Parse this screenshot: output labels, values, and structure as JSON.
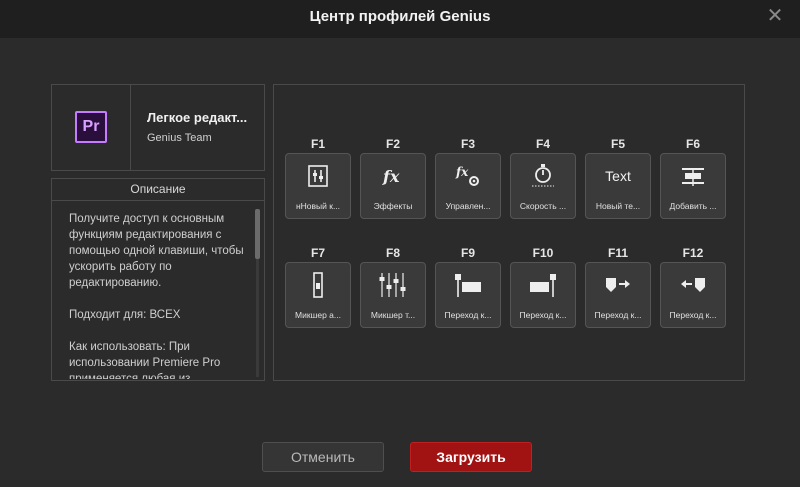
{
  "dialog": {
    "title": "Центр профилей Genius",
    "close_glyph": "✕"
  },
  "profile": {
    "logo_text": "Pr",
    "name": "Легкое редакт...",
    "author": "Genius Team"
  },
  "description": {
    "header": "Описание",
    "paragraphs": [
      "Получите доступ к основным функциям редактирования с помощью одной клавиши, чтобы ускорить работу по редактированию.",
      "Подходит для: ВСЕХ",
      "Как использовать: При использовании Premiere Pro применяется любая из"
    ]
  },
  "keys": [
    {
      "key": "F1",
      "label": "нНовый к...",
      "icon": "sequence-icon"
    },
    {
      "key": "F2",
      "label": "Эффекты",
      "icon": "fx-icon"
    },
    {
      "key": "F3",
      "label": "Управлен...",
      "icon": "fx-controls-icon"
    },
    {
      "key": "F4",
      "label": "Скорость ...",
      "icon": "stopwatch-icon"
    },
    {
      "key": "F5",
      "label": "Новый те...",
      "icon": "text-icon",
      "icon_text": "Text"
    },
    {
      "key": "F6",
      "label": "Добавить ...",
      "icon": "add-track-icon"
    },
    {
      "key": "F7",
      "label": "Микшер а...",
      "icon": "audio-mixer-icon"
    },
    {
      "key": "F8",
      "label": "Микшер т...",
      "icon": "track-mixer-icon"
    },
    {
      "key": "F9",
      "label": "Переход к...",
      "icon": "go-to-start-icon"
    },
    {
      "key": "F10",
      "label": "Переход к...",
      "icon": "go-to-end-icon"
    },
    {
      "key": "F11",
      "label": "Переход к...",
      "icon": "next-marker-icon"
    },
    {
      "key": "F12",
      "label": "Переход к...",
      "icon": "prev-marker-icon"
    }
  ],
  "buttons": {
    "cancel": "Отменить",
    "load": "Загрузить"
  },
  "colors": {
    "accent": "#a11212",
    "background": "#2b2b2b"
  }
}
